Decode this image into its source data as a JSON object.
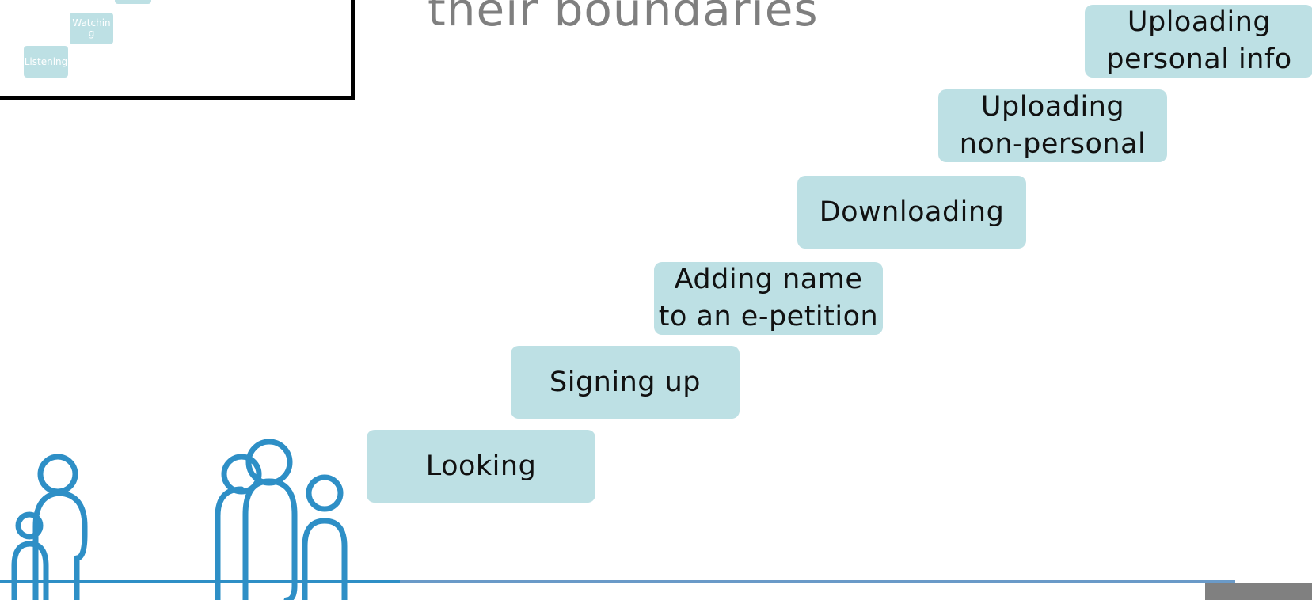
{
  "title": "their boundaries",
  "thumbnail": {
    "items": [
      {
        "label": "Watchin\ng"
      },
      {
        "label": "Listening"
      }
    ]
  },
  "steps": [
    {
      "label": "Looking"
    },
    {
      "label": "Signing up"
    },
    {
      "label": "Adding name\nto an e-petition"
    },
    {
      "label": "Downloading"
    },
    {
      "label": "Uploading\nnon-personal"
    },
    {
      "label": "Uploading\npersonal info"
    }
  ],
  "colors": {
    "box": "#bde0e4",
    "title": "#7f7f7f",
    "people": "#2e8fc6"
  },
  "icons": [
    "people-group-icon"
  ]
}
